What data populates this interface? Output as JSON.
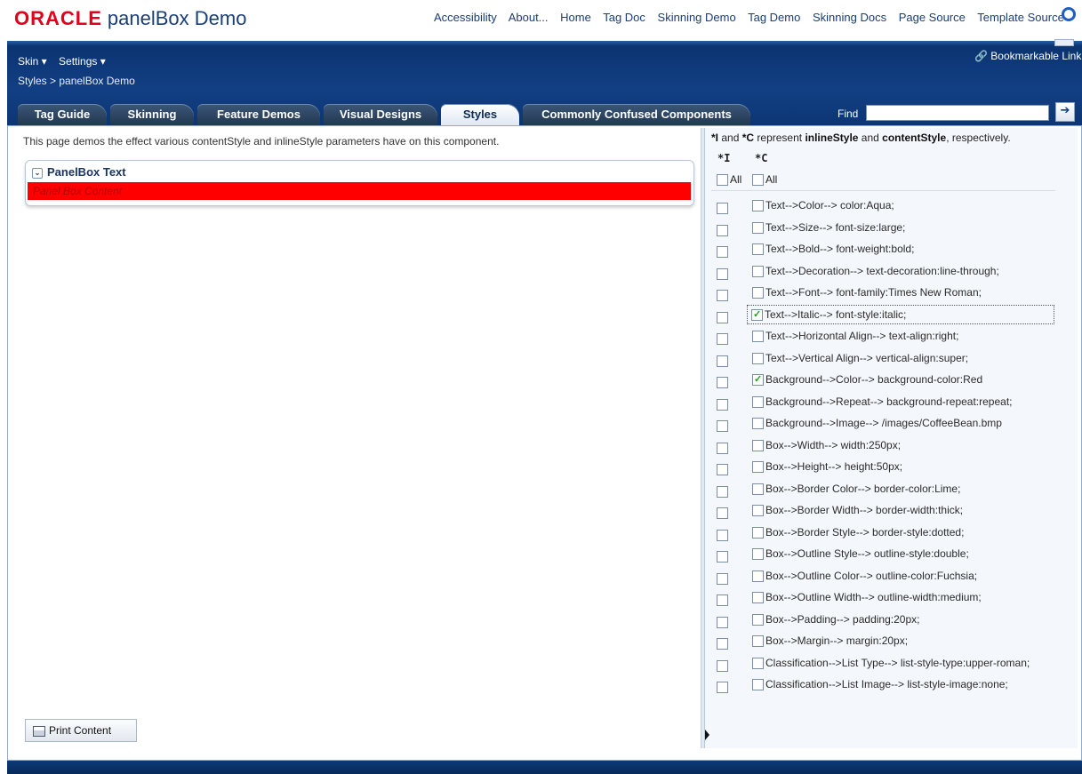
{
  "app": {
    "brand": "ORACLE",
    "page_title": "panelBox Demo",
    "top_links": [
      "Accessibility",
      "About...",
      "Home",
      "Tag Doc",
      "Skinning Demo",
      "Tag Demo",
      "Skinning Docs",
      "Page Source",
      "Template Source"
    ]
  },
  "menubar": {
    "skin": "Skin ▾",
    "settings": "Settings ▾"
  },
  "breadcrumb": "Styles > panelBox Demo",
  "bookmark": "🔗 Bookmarkable Link",
  "tabs": [
    {
      "label": "Tag Guide",
      "active": false
    },
    {
      "label": "Skinning",
      "active": false
    },
    {
      "label": "Feature Demos",
      "active": false
    },
    {
      "label": "Visual Designs",
      "active": false
    },
    {
      "label": "Styles",
      "active": true
    },
    {
      "label": "Commonly Confused Components",
      "active": false
    }
  ],
  "find": {
    "label": "Find",
    "value": "",
    "button": "➔"
  },
  "main": {
    "intro": "This page demos the effect various contentStyle and inlineStyle parameters have on this component.",
    "panelbox": {
      "title": "PanelBox Text",
      "content": "Panel Box Content",
      "disclose_icon": "⌄"
    },
    "print_button": "Print Content"
  },
  "right": {
    "legend_parts": {
      "i_code": "*I",
      "and": " and ",
      "c_code": "*C",
      "represent": " represent ",
      "inline": "inlineStyle",
      "and2": " and ",
      "content": "contentStyle",
      "tail": ", respectively."
    },
    "header_i": "*I",
    "header_c": "*C",
    "all_label": "All",
    "items": [
      {
        "label": "Text-->Color--> color:Aqua;",
        "i": false,
        "c": false
      },
      {
        "label": "Text-->Size--> font-size:large;",
        "i": false,
        "c": false
      },
      {
        "label": "Text-->Bold--> font-weight:bold;",
        "i": false,
        "c": false
      },
      {
        "label": "Text-->Decoration--> text-decoration:line-through;",
        "i": false,
        "c": false
      },
      {
        "label": "Text-->Font--> font-family:Times New Roman;",
        "i": false,
        "c": false
      },
      {
        "label": "Text-->Italic--> font-style:italic;",
        "i": false,
        "c": true
      },
      {
        "label": "Text-->Horizontal Align--> text-align:right;",
        "i": false,
        "c": false
      },
      {
        "label": "Text-->Vertical Align--> vertical-align:super;",
        "i": false,
        "c": false
      },
      {
        "label": "Background-->Color--> background-color:Red",
        "i": false,
        "c": true
      },
      {
        "label": "Background-->Repeat--> background-repeat:repeat;",
        "i": false,
        "c": false
      },
      {
        "label": "Background-->Image--> /images/CoffeeBean.bmp",
        "i": false,
        "c": false
      },
      {
        "label": "Box-->Width--> width:250px;",
        "i": false,
        "c": false
      },
      {
        "label": "Box-->Height--> height:50px;",
        "i": false,
        "c": false
      },
      {
        "label": "Box-->Border Color--> border-color:Lime;",
        "i": false,
        "c": false
      },
      {
        "label": "Box-->Border Width--> border-width:thick;",
        "i": false,
        "c": false
      },
      {
        "label": "Box-->Border Style--> border-style:dotted;",
        "i": false,
        "c": false
      },
      {
        "label": "Box-->Outline Style--> outline-style:double;",
        "i": false,
        "c": false
      },
      {
        "label": "Box-->Outline Color--> outline-color:Fuchsia;",
        "i": false,
        "c": false
      },
      {
        "label": "Box-->Outline Width--> outline-width:medium;",
        "i": false,
        "c": false
      },
      {
        "label": "Box-->Padding--> padding:20px;",
        "i": false,
        "c": false
      },
      {
        "label": "Box-->Margin--> margin:20px;",
        "i": false,
        "c": false
      },
      {
        "label": "Classification-->List Type--> list-style-type:upper-roman;",
        "i": false,
        "c": false
      },
      {
        "label": "Classification-->List Image--> list-style-image:none;",
        "i": false,
        "c": false
      }
    ]
  },
  "colors": {
    "brand_red": "#e2001a",
    "band_blue": "#123f84",
    "content_red": "#ff0000"
  }
}
